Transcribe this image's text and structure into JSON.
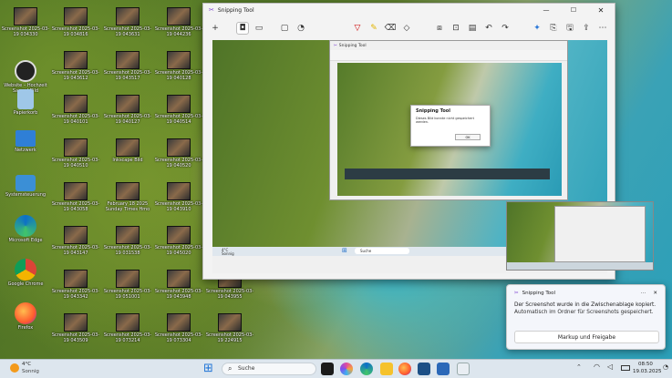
{
  "desktop": {
    "icons": [
      {
        "label": "Screenshot 2025-03-19 034330"
      },
      {
        "label": "Screenshot 2025-03-19 034816"
      },
      {
        "label": "Screenshot 2025-03-19 043631"
      },
      {
        "label": "Screenshot 2025-03-19 044236"
      },
      {
        "label": "Website – Hochzeit Sacred Bild"
      },
      {
        "label": "Screenshot 2025-03-19 043612"
      },
      {
        "label": "Screenshot 2025-03-19 043517"
      },
      {
        "label": "Screenshot 2025-03-19 040128"
      },
      {
        "label": "Papierkorb"
      },
      {
        "label": "Screenshot 2025-03-19 040101"
      },
      {
        "label": "Screenshot 2025-03-19 040127"
      },
      {
        "label": "Screenshot 2025-03-19 040514"
      },
      {
        "label": "Netzwerk"
      },
      {
        "label": "Screenshot 2025-03-19 040510"
      },
      {
        "label": "Inkscape Bild"
      },
      {
        "label": "Screenshot 2025-03-19 040520"
      },
      {
        "label": "Systemsteuerung"
      },
      {
        "label": "Screenshot 2025-03-19 043058"
      },
      {
        "label": "February 18 2025 Sunday Times Hmo"
      },
      {
        "label": "Screenshot 2025-03-19 043910"
      },
      {
        "label": "Microsoft Edge"
      },
      {
        "label": "Screenshot 2025-03-19 043147"
      },
      {
        "label": "Screenshot 2025-03-19 031538"
      },
      {
        "label": "Screenshot 2025-03-19 045020"
      },
      {
        "label": "Google Chrome"
      },
      {
        "label": "Screenshot 2025-03-19 043342"
      },
      {
        "label": "Screenshot 2025-03-19 051001"
      },
      {
        "label": "Screenshot 2025-03-19 043948"
      },
      {
        "label": "Screenshot 2025-03-19 043955"
      },
      {
        "label": "Firefox"
      },
      {
        "label": "Screenshot 2025-03-19 043509"
      },
      {
        "label": "Screenshot 2025-03-19 073214"
      },
      {
        "label": "Screenshot 2025-03-19 073304"
      },
      {
        "label": "Screenshot 2025-03-19 224915"
      }
    ]
  },
  "snip": {
    "title": "Snipping Tool",
    "inner_title": "Snipping Tool",
    "dialog_title": "Snipping Tool",
    "dialog_msg": "Dieses Bild konnte nicht gespeichert werden.",
    "dialog_ok": "OK"
  },
  "toast": {
    "app": "Snipping Tool",
    "line1": "Der Screenshot wurde in die Zwischenablage kopiert.",
    "line2": "Automatisch im Ordner für Screenshots gespeichert.",
    "button": "Markup und Freigabe"
  },
  "taskbar": {
    "weather_temp": "4°C",
    "weather_desc": "Sonnig",
    "search": "Suche",
    "time": "08:50",
    "date": "19.03.2025"
  },
  "inner_taskbar": {
    "weather_temp": "4°C",
    "weather_desc": "Sonnig",
    "search": "Suche"
  }
}
